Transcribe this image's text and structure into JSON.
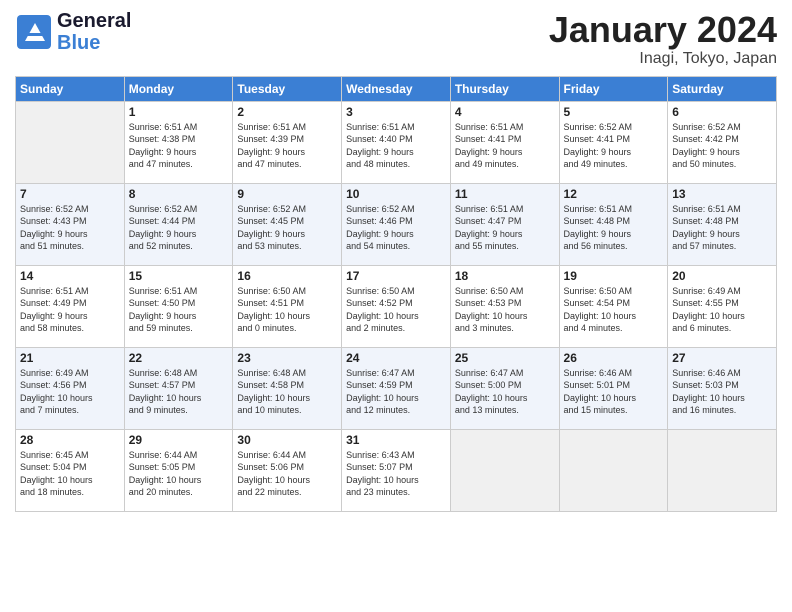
{
  "header": {
    "logo_line1": "General",
    "logo_line2": "Blue",
    "month_title": "January 2024",
    "location": "Inagi, Tokyo, Japan"
  },
  "days_of_week": [
    "Sunday",
    "Monday",
    "Tuesday",
    "Wednesday",
    "Thursday",
    "Friday",
    "Saturday"
  ],
  "weeks": [
    [
      {
        "day": "",
        "info": ""
      },
      {
        "day": "1",
        "info": "Sunrise: 6:51 AM\nSunset: 4:38 PM\nDaylight: 9 hours\nand 47 minutes."
      },
      {
        "day": "2",
        "info": "Sunrise: 6:51 AM\nSunset: 4:39 PM\nDaylight: 9 hours\nand 47 minutes."
      },
      {
        "day": "3",
        "info": "Sunrise: 6:51 AM\nSunset: 4:40 PM\nDaylight: 9 hours\nand 48 minutes."
      },
      {
        "day": "4",
        "info": "Sunrise: 6:51 AM\nSunset: 4:41 PM\nDaylight: 9 hours\nand 49 minutes."
      },
      {
        "day": "5",
        "info": "Sunrise: 6:52 AM\nSunset: 4:41 PM\nDaylight: 9 hours\nand 49 minutes."
      },
      {
        "day": "6",
        "info": "Sunrise: 6:52 AM\nSunset: 4:42 PM\nDaylight: 9 hours\nand 50 minutes."
      }
    ],
    [
      {
        "day": "7",
        "info": "Sunrise: 6:52 AM\nSunset: 4:43 PM\nDaylight: 9 hours\nand 51 minutes."
      },
      {
        "day": "8",
        "info": "Sunrise: 6:52 AM\nSunset: 4:44 PM\nDaylight: 9 hours\nand 52 minutes."
      },
      {
        "day": "9",
        "info": "Sunrise: 6:52 AM\nSunset: 4:45 PM\nDaylight: 9 hours\nand 53 minutes."
      },
      {
        "day": "10",
        "info": "Sunrise: 6:52 AM\nSunset: 4:46 PM\nDaylight: 9 hours\nand 54 minutes."
      },
      {
        "day": "11",
        "info": "Sunrise: 6:51 AM\nSunset: 4:47 PM\nDaylight: 9 hours\nand 55 minutes."
      },
      {
        "day": "12",
        "info": "Sunrise: 6:51 AM\nSunset: 4:48 PM\nDaylight: 9 hours\nand 56 minutes."
      },
      {
        "day": "13",
        "info": "Sunrise: 6:51 AM\nSunset: 4:48 PM\nDaylight: 9 hours\nand 57 minutes."
      }
    ],
    [
      {
        "day": "14",
        "info": "Sunrise: 6:51 AM\nSunset: 4:49 PM\nDaylight: 9 hours\nand 58 minutes."
      },
      {
        "day": "15",
        "info": "Sunrise: 6:51 AM\nSunset: 4:50 PM\nDaylight: 9 hours\nand 59 minutes."
      },
      {
        "day": "16",
        "info": "Sunrise: 6:50 AM\nSunset: 4:51 PM\nDaylight: 10 hours\nand 0 minutes."
      },
      {
        "day": "17",
        "info": "Sunrise: 6:50 AM\nSunset: 4:52 PM\nDaylight: 10 hours\nand 2 minutes."
      },
      {
        "day": "18",
        "info": "Sunrise: 6:50 AM\nSunset: 4:53 PM\nDaylight: 10 hours\nand 3 minutes."
      },
      {
        "day": "19",
        "info": "Sunrise: 6:50 AM\nSunset: 4:54 PM\nDaylight: 10 hours\nand 4 minutes."
      },
      {
        "day": "20",
        "info": "Sunrise: 6:49 AM\nSunset: 4:55 PM\nDaylight: 10 hours\nand 6 minutes."
      }
    ],
    [
      {
        "day": "21",
        "info": "Sunrise: 6:49 AM\nSunset: 4:56 PM\nDaylight: 10 hours\nand 7 minutes."
      },
      {
        "day": "22",
        "info": "Sunrise: 6:48 AM\nSunset: 4:57 PM\nDaylight: 10 hours\nand 9 minutes."
      },
      {
        "day": "23",
        "info": "Sunrise: 6:48 AM\nSunset: 4:58 PM\nDaylight: 10 hours\nand 10 minutes."
      },
      {
        "day": "24",
        "info": "Sunrise: 6:47 AM\nSunset: 4:59 PM\nDaylight: 10 hours\nand 12 minutes."
      },
      {
        "day": "25",
        "info": "Sunrise: 6:47 AM\nSunset: 5:00 PM\nDaylight: 10 hours\nand 13 minutes."
      },
      {
        "day": "26",
        "info": "Sunrise: 6:46 AM\nSunset: 5:01 PM\nDaylight: 10 hours\nand 15 minutes."
      },
      {
        "day": "27",
        "info": "Sunrise: 6:46 AM\nSunset: 5:03 PM\nDaylight: 10 hours\nand 16 minutes."
      }
    ],
    [
      {
        "day": "28",
        "info": "Sunrise: 6:45 AM\nSunset: 5:04 PM\nDaylight: 10 hours\nand 18 minutes."
      },
      {
        "day": "29",
        "info": "Sunrise: 6:44 AM\nSunset: 5:05 PM\nDaylight: 10 hours\nand 20 minutes."
      },
      {
        "day": "30",
        "info": "Sunrise: 6:44 AM\nSunset: 5:06 PM\nDaylight: 10 hours\nand 22 minutes."
      },
      {
        "day": "31",
        "info": "Sunrise: 6:43 AM\nSunset: 5:07 PM\nDaylight: 10 hours\nand 23 minutes."
      },
      {
        "day": "",
        "info": ""
      },
      {
        "day": "",
        "info": ""
      },
      {
        "day": "",
        "info": ""
      }
    ]
  ]
}
